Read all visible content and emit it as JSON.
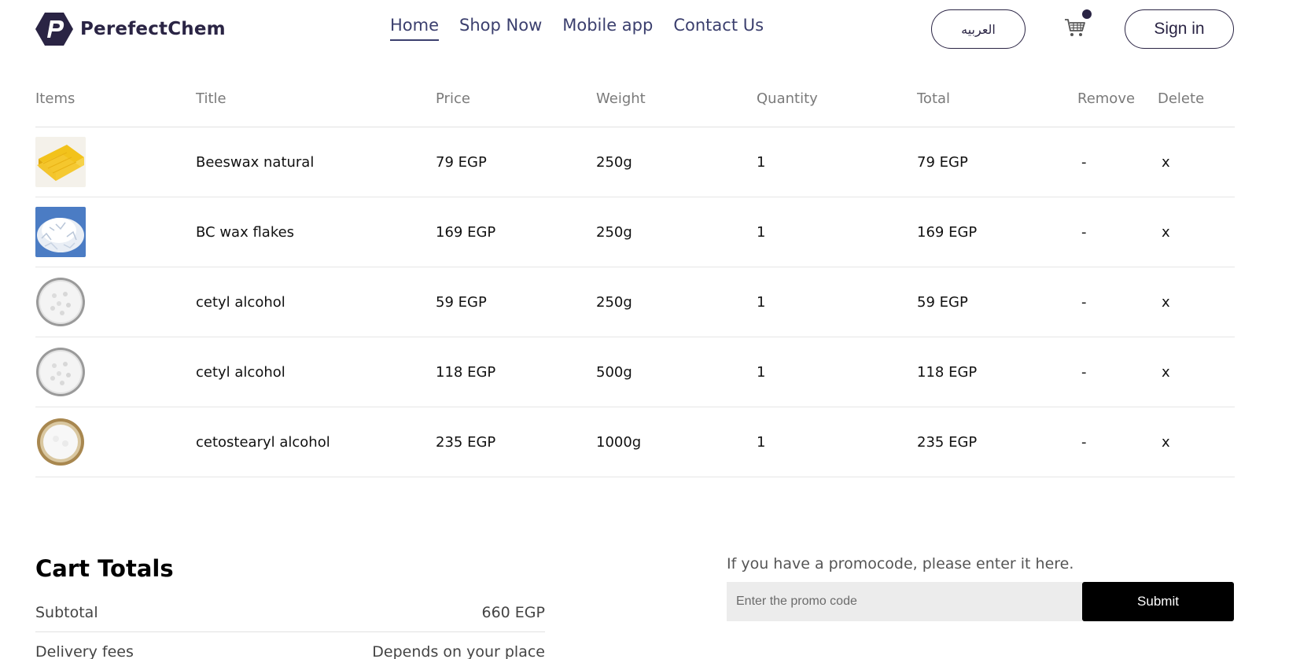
{
  "brand": {
    "name": "PerefectChem"
  },
  "nav": [
    {
      "label": "Home",
      "active": true
    },
    {
      "label": "Shop Now",
      "active": false
    },
    {
      "label": "Mobile app",
      "active": false
    },
    {
      "label": "Contact Us",
      "active": false
    }
  ],
  "header": {
    "language_label": "العربيه",
    "cart_icon": "shopping-cart-icon",
    "signin_label": "Sign in"
  },
  "table": {
    "headers": [
      "Items",
      "Title",
      "Price",
      "Weight",
      "Quantity",
      "Total",
      "Remove",
      "Delete"
    ],
    "rows": [
      {
        "thumb": "beeswax",
        "title": "Beeswax natural",
        "price": "79 EGP",
        "weight": "250g",
        "quantity": "1",
        "total": "79 EGP",
        "remove": "-",
        "delete": "x"
      },
      {
        "thumb": "flakes",
        "title": "BC wax flakes",
        "price": "169 EGP",
        "weight": "250g",
        "quantity": "1",
        "total": "169 EGP",
        "remove": "-",
        "delete": "x"
      },
      {
        "thumb": "dish",
        "title": "cetyl alcohol",
        "price": "59 EGP",
        "weight": "250g",
        "quantity": "1",
        "total": "59 EGP",
        "remove": "-",
        "delete": "x"
      },
      {
        "thumb": "dish",
        "title": "cetyl alcohol",
        "price": "118 EGP",
        "weight": "500g",
        "quantity": "1",
        "total": "118 EGP",
        "remove": "-",
        "delete": "x"
      },
      {
        "thumb": "bowl",
        "title": "cetostearyl alcohol",
        "price": "235 EGP",
        "weight": "1000g",
        "quantity": "1",
        "total": "235 EGP",
        "remove": "-",
        "delete": "x"
      }
    ]
  },
  "totals": {
    "title": "Cart Totals",
    "subtotal_label": "Subtotal",
    "subtotal_value": "660 EGP",
    "delivery_label": "Delivery fees",
    "delivery_value": "Depends on your place"
  },
  "promo": {
    "label": "If you have a promocode, please enter it here.",
    "placeholder": "Enter the promo code",
    "submit_label": "Submit"
  }
}
